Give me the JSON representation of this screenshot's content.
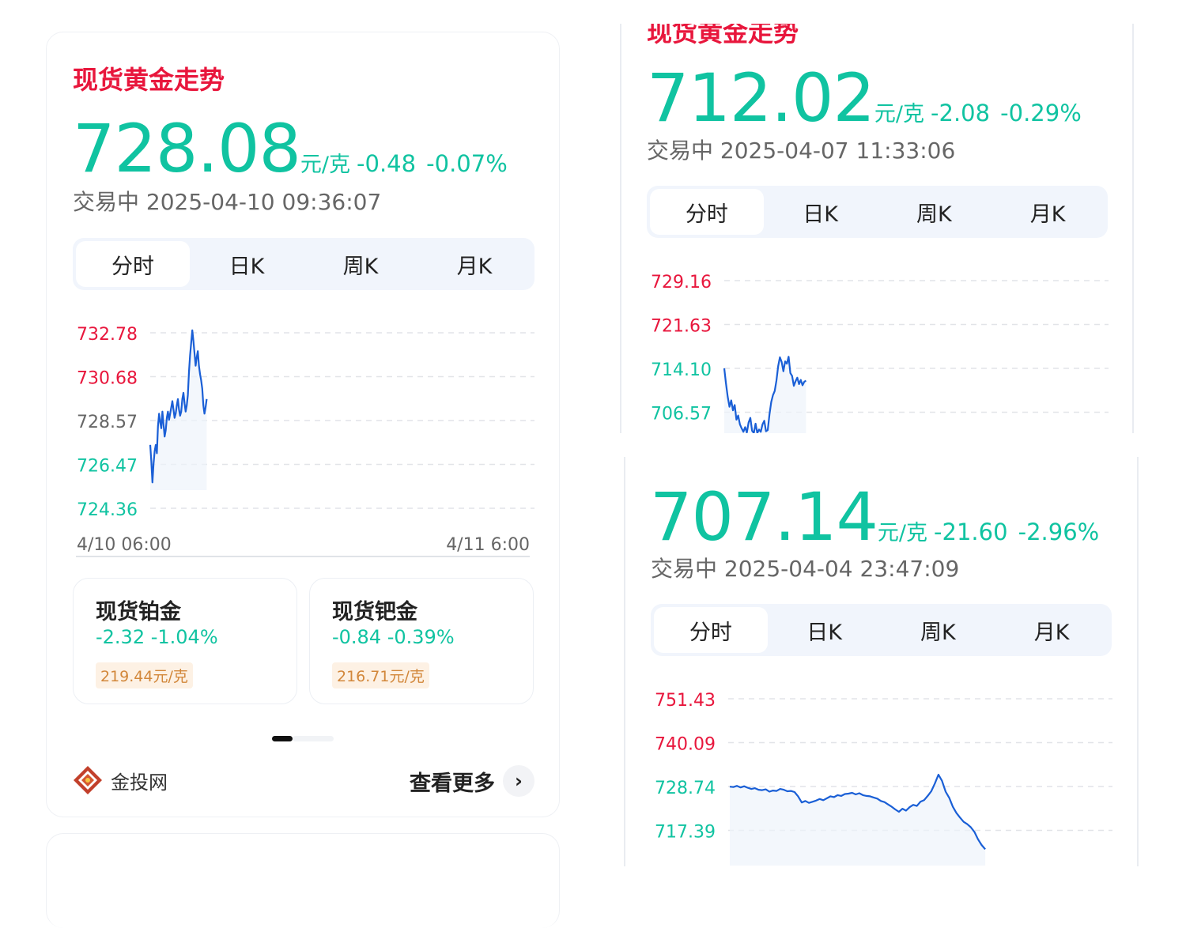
{
  "panel_a": {
    "title": "现货黄金走势",
    "price": "728.08",
    "unit": "元/克",
    "change": "-0.48",
    "change_pct": "-0.07%",
    "status": "交易中 2025-04-10 09:36:07",
    "tabs": [
      "分时",
      "日K",
      "周K",
      "月K"
    ],
    "active_tab": "分时",
    "chart_data": {
      "type": "line",
      "y_ticks": [
        "732.78",
        "730.68",
        "728.57",
        "726.47",
        "724.36"
      ],
      "x_start_label": "4/10 06:00",
      "x_end_label": "4/11 6:00",
      "ylim": [
        724.36,
        732.78
      ],
      "line_color": "#1a5fd6",
      "values": [
        727.4,
        726.6,
        725.6,
        726.5,
        727.1,
        727.4,
        727.0,
        728.3,
        728.9,
        728.5,
        728.2,
        729.0,
        728.4,
        727.8,
        728.1,
        728.7,
        729.0,
        728.6,
        728.9,
        729.2,
        729.5,
        729.1,
        728.7,
        728.9,
        729.3,
        729.6,
        729.1,
        728.8,
        729.0,
        729.6,
        729.9,
        729.4,
        729.0,
        729.3,
        729.8,
        730.9,
        731.7,
        732.3,
        732.9,
        732.4,
        731.8,
        731.2,
        731.6,
        731.9,
        731.2,
        730.8,
        730.5,
        730.1,
        729.3,
        728.9,
        729.2,
        729.6
      ]
    },
    "metals": [
      {
        "name": "现货铂金",
        "change": "-2.32 -1.04%",
        "price": "219.44元/克"
      },
      {
        "name": "现货钯金",
        "change": "-0.84 -0.39%",
        "price": "216.71元/克"
      }
    ],
    "brand": "金投网",
    "more_label": "查看更多"
  },
  "panel_b": {
    "title": "现货黄金走势",
    "price": "712.02",
    "unit": "元/克",
    "change": "-2.08",
    "change_pct": "-0.29%",
    "status": "交易中 2025-04-07 11:33:06",
    "tabs": [
      "分时",
      "日K",
      "周K",
      "月K"
    ],
    "active_tab": "分时",
    "chart_data": {
      "type": "line",
      "y_ticks": [
        "729.16",
        "721.63",
        "714.10",
        "706.57"
      ],
      "ylim": [
        706.57,
        729.16
      ],
      "line_color": "#1a5fd6",
      "values": [
        714.1,
        711.5,
        709.2,
        707.5,
        708.6,
        706.9,
        707.8,
        705.3,
        706.0,
        704.5,
        703.8,
        703.2,
        704.0,
        703.1,
        704.8,
        705.6,
        703.4,
        703.0,
        704.6,
        703.0,
        703.6,
        703.2,
        704.5,
        705.1,
        703.3,
        703.5,
        706.2,
        708.3,
        709.5,
        710.2,
        712.0,
        714.5,
        716.0,
        715.2,
        713.6,
        715.3,
        714.9,
        716.1,
        713.3,
        712.8,
        711.1,
        711.9,
        712.5,
        711.4,
        712.1,
        711.2,
        711.8,
        712.0
      ]
    }
  },
  "panel_c": {
    "price": "707.14",
    "unit": "元/克",
    "change": "-21.60",
    "change_pct": "-2.96%",
    "status": "交易中 2025-04-04 23:47:09",
    "tabs": [
      "分时",
      "日K",
      "周K",
      "月K"
    ],
    "active_tab": "分时",
    "chart_data": {
      "type": "line",
      "y_ticks": [
        "751.43",
        "740.09",
        "728.74",
        "717.39"
      ],
      "ylim": [
        717.39,
        751.43
      ],
      "line_color": "#1a5fd6",
      "values": [
        728.7,
        728.6,
        728.9,
        728.5,
        728.8,
        728.4,
        728.1,
        728.3,
        727.9,
        727.8,
        728.0,
        727.4,
        727.7,
        727.6,
        728.1,
        727.9,
        727.5,
        727.6,
        727.3,
        726.2,
        724.6,
        725.0,
        724.5,
        724.8,
        725.1,
        725.5,
        725.2,
        725.7,
        726.2,
        726.0,
        726.5,
        726.3,
        726.8,
        726.9,
        727.1,
        726.7,
        727.0,
        726.5,
        726.3,
        726.2,
        725.9,
        725.6,
        725.0,
        724.7,
        724.1,
        723.5,
        722.8,
        722.2,
        723.0,
        722.5,
        723.4,
        724.0,
        723.7,
        724.8,
        725.2,
        726.3,
        727.5,
        729.5,
        731.8,
        730.2,
        727.4,
        725.8,
        723.5,
        721.9,
        720.7,
        719.6,
        719.0,
        718.2,
        717.0,
        715.1,
        713.6,
        712.5
      ]
    }
  }
}
